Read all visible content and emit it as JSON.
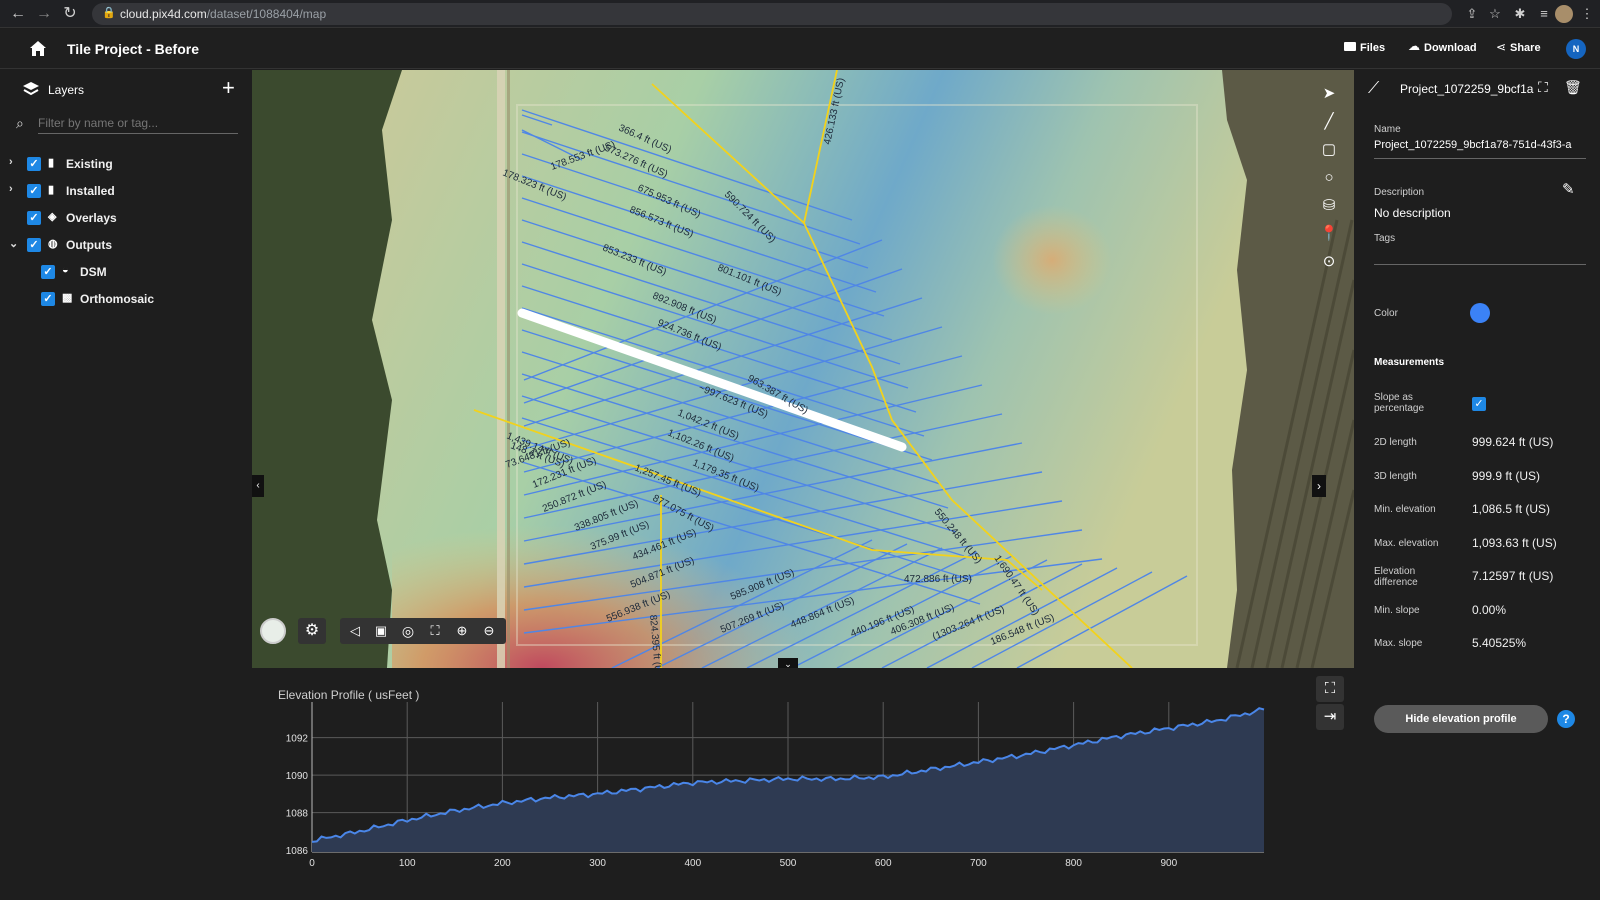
{
  "browser": {
    "url_host": "cloud.pix4d.com",
    "url_path": "/dataset/1088404/map"
  },
  "header": {
    "title": "Tile Project - Before",
    "files_label": "Files",
    "download_label": "Download",
    "share_label": "Share",
    "avatar_initial": "N"
  },
  "sidebar": {
    "title": "Layers",
    "filter_placeholder": "Filter by name or tag...",
    "items": [
      {
        "label": "Existing",
        "expandable": true,
        "expanded": false,
        "checked": true,
        "icon": "comment-icon"
      },
      {
        "label": "Installed",
        "expandable": true,
        "expanded": false,
        "checked": true,
        "icon": "comment-icon"
      },
      {
        "label": "Overlays",
        "expandable": false,
        "expanded": false,
        "checked": true,
        "icon": "layers-icon"
      },
      {
        "label": "Outputs",
        "expandable": true,
        "expanded": true,
        "checked": true,
        "icon": "globe-icon"
      },
      {
        "label": "DSM",
        "child": true,
        "checked": true,
        "icon": "dsm-icon"
      },
      {
        "label": "Orthomosaic",
        "child": true,
        "checked": true,
        "icon": "orthomosaic-icon"
      }
    ]
  },
  "map": {
    "labels": [
      "366.4 ft (US)",
      "573.276 ft (US)",
      "178.553 ft (US)",
      "178.323 ft (US)",
      "675.953 ft (US)",
      "590.724 ft (US)",
      "426.133 ft (US)",
      "856.573 ft (US)",
      "853.233 ft (US)",
      "801.101 ft (US)",
      "892.908 ft (US)",
      "924.736 ft (US)",
      "963.387 ft (US)",
      "~997.623 ft (US)",
      "1,042.2 ft (US)",
      "1,102.26 ft (US)",
      "1,439.14 ft (US)",
      "148.4 ft (US)",
      "73.6481 ft (US)",
      "1,179.35 ft (US)",
      "172.231 ft (US)",
      "1,257.45 ft (US)",
      "250.872 ft (US)",
      "877.075 ft (US)",
      "338.805 ft (US)",
      "550.248 ft (US)",
      "375.99 ft (US)",
      "434.461 ft (US)",
      "1,690.47 ft (US)",
      "504.871 ft (US)",
      "472.886 ft (US)",
      "585.908 ft (US)",
      "556.938 ft (US)",
      "507.269 ft (US)",
      "448.864 ft (US)",
      "440.196 ft (US)",
      "406.308 ft (US)",
      "(1303.264 ft (US)",
      "186.548 ft (US)",
      "824.395 ft (US)"
    ]
  },
  "right_panel": {
    "project_name_short": "Project_1072259_9bcf1a",
    "name_label": "Name",
    "name_value": "Project_1072259_9bcf1a78-751d-43f3-a",
    "description_label": "Description",
    "description_value": "No description",
    "tags_label": "Tags",
    "color_label": "Color",
    "color_value": "#3b82f6",
    "measurements_title": "Measurements",
    "slope_label": "Slope as percentage",
    "slope_checked": true,
    "rows": [
      {
        "label": "2D length",
        "value": "999.624 ft (US)"
      },
      {
        "label": "3D length",
        "value": "999.9 ft (US)"
      },
      {
        "label": "Min. elevation",
        "value": "1,086.5 ft (US)"
      },
      {
        "label": "Max. elevation",
        "value": "1,093.63 ft (US)"
      },
      {
        "label": "Elevation difference",
        "value": "7.12597 ft (US)"
      },
      {
        "label": "Min. slope",
        "value": "0.00%"
      },
      {
        "label": "Max. slope",
        "value": "5.40525%"
      }
    ],
    "hide_profile_label": "Hide elevation profile"
  },
  "chart_data": {
    "type": "area",
    "title": "Elevation Profile ( usFeet )",
    "xlabel": "",
    "ylabel": "",
    "x_ticks": [
      0,
      100,
      200,
      300,
      400,
      500,
      600,
      700,
      800,
      900
    ],
    "y_ticks": [
      1086,
      1088,
      1090,
      1092
    ],
    "xlim": [
      0,
      1000
    ],
    "ylim": [
      1085.9,
      1093.9
    ],
    "series": [
      {
        "x": [
          0,
          50,
          100,
          150,
          200,
          250,
          300,
          350,
          400,
          450,
          500,
          550,
          600,
          650,
          700,
          750,
          800,
          850,
          900,
          950,
          1000
        ],
        "values": [
          1086.5,
          1087.0,
          1087.6,
          1088.1,
          1088.5,
          1088.8,
          1089.0,
          1089.3,
          1089.6,
          1089.7,
          1089.8,
          1089.8,
          1089.9,
          1090.3,
          1090.7,
          1091.1,
          1091.6,
          1092.1,
          1092.5,
          1092.9,
          1093.5
        ]
      }
    ],
    "line_color": "#4a86e8",
    "fill_color": "#2e3a52",
    "grid": true
  }
}
